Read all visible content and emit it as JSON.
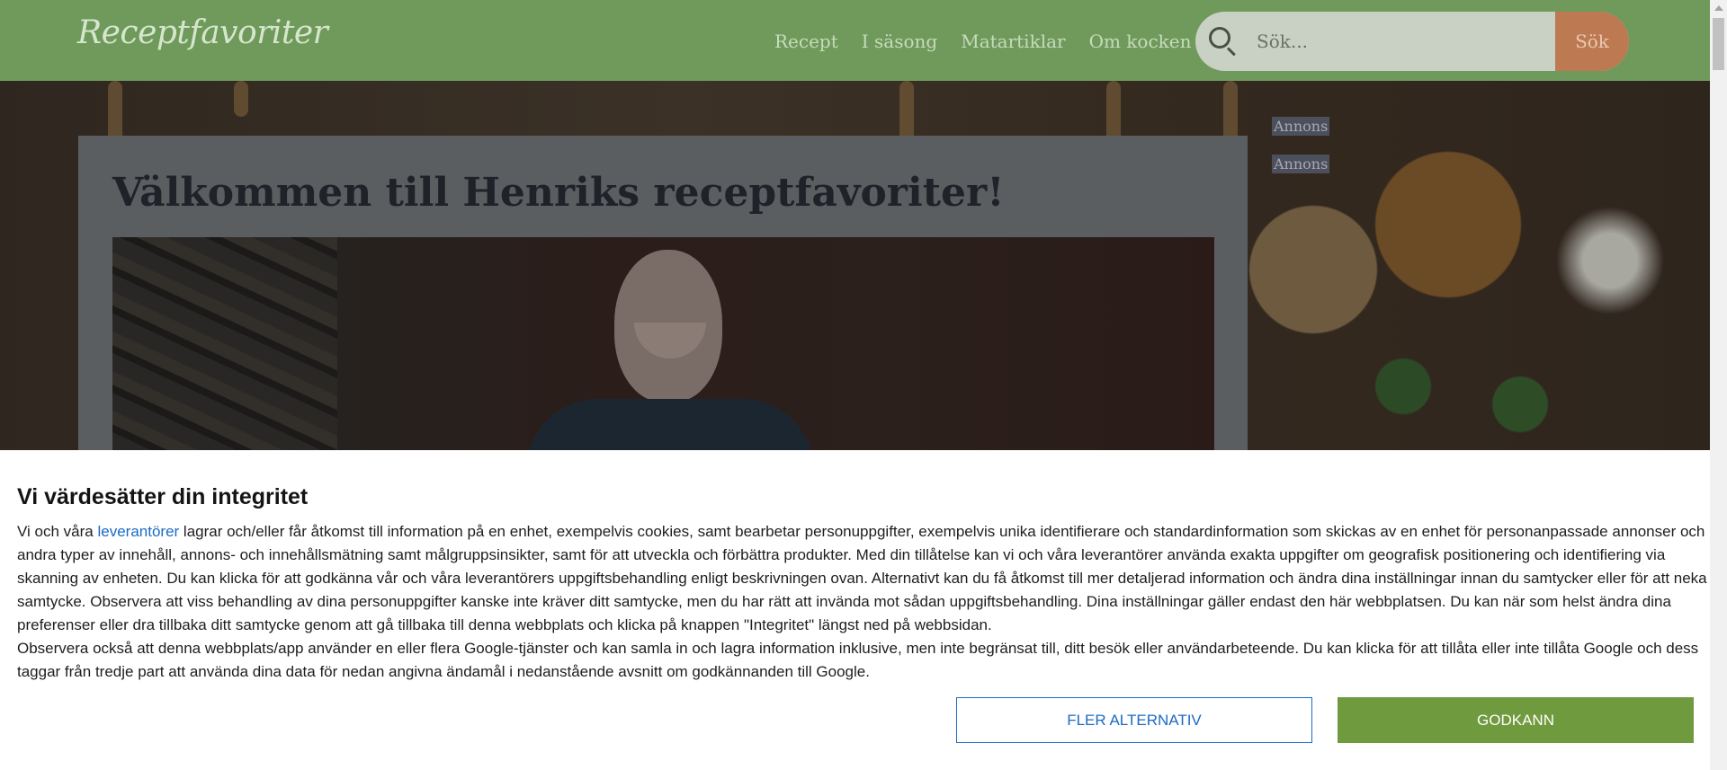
{
  "header": {
    "logo": "Receptfavoriter",
    "nav": [
      "Recept",
      "I säsong",
      "Matartiklar",
      "Om kocken"
    ],
    "search_placeholder": "Sök...",
    "search_button": "Sök"
  },
  "main": {
    "title": "Välkommen till Henriks receptfavoriter!",
    "ads": [
      "Annons",
      "Annons"
    ]
  },
  "consent": {
    "heading": "Vi värdesätter din integritet",
    "para1_pre": "Vi och våra ",
    "para1_link": "leverantörer",
    "para1_post": " lagrar och/eller får åtkomst till information på en enhet, exempelvis cookies, samt bearbetar personuppgifter, exempelvis unika identifierare och standardinformation som skickas av en enhet för personanpassade annonser och andra typer av innehåll, annons- och innehållsmätning samt målgruppsinsikter, samt för att utveckla och förbättra produkter. Med din tillåtelse kan vi och våra leverantörer använda exakta uppgifter om geografisk positionering och identifiering via skanning av enheten. Du kan klicka för att godkänna vår och våra leverantörers uppgiftsbehandling enligt beskrivningen ovan. Alternativt kan du få åtkomst till mer detaljerad information och ändra dina inställningar innan du samtycker eller för att neka samtycke. Observera att viss behandling av dina personuppgifter kanske inte kräver ditt samtycke, men du har rätt att invända mot sådan uppgiftsbehandling. Dina inställningar gäller endast den här webbplatsen. Du kan när som helst ändra dina preferenser eller dra tillbaka ditt samtycke genom att gå tillbaka till denna webbplats och klicka på knappen \"Integritet\" längst ned på webbsidan.",
    "para2": "Observera också att denna webbplats/app använder en eller flera Google-tjänster och kan samla in och lagra information inklusive, men inte begränsat till, ditt besök eller användarbeteende. Du kan klicka för att tillåta eller inte tillåta Google och dess taggar från tredje part att använda dina data för nedan angivna ändamål i nedanstående avsnitt om godkännanden till Google.",
    "more_options": "FLER ALTERNATIV",
    "accept": "GODKANN"
  }
}
